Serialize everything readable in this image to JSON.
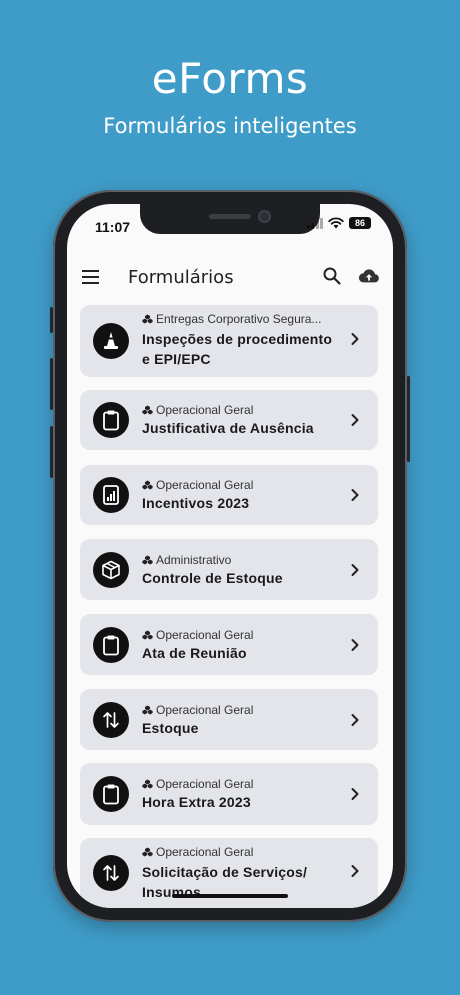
{
  "hero": {
    "title": "eForms",
    "subtitle": "Formulários inteligentes"
  },
  "status_bar": {
    "time": "11:07",
    "battery": "86"
  },
  "app_bar": {
    "title": "Formulários",
    "icons": [
      "menu-icon",
      "search-icon",
      "cloud-upload-icon"
    ]
  },
  "forms": [
    {
      "category": "Entregas Corporativo Segura...",
      "title": "Inspeções de procedimento e EPI/EPC",
      "icon": "traffic-cone-icon"
    },
    {
      "category": "Operacional Geral",
      "title": "Justificativa de Ausência",
      "icon": "clipboard-icon"
    },
    {
      "category": "Operacional Geral",
      "title": "Incentivos 2023",
      "icon": "chart-tablet-icon"
    },
    {
      "category": "Administrativo",
      "title": "Controle de Estoque",
      "icon": "box-icon"
    },
    {
      "category": "Operacional Geral",
      "title": "Ata de Reunião",
      "icon": "clipboard-icon"
    },
    {
      "category": "Operacional Geral",
      "title": "Estoque",
      "icon": "swap-arrows-icon"
    },
    {
      "category": "Operacional Geral",
      "title": "Hora Extra 2023",
      "icon": "clipboard-icon"
    },
    {
      "category": "Operacional Geral",
      "title": "Solicitação de Serviços/ Insumos",
      "icon": "swap-arrows-icon"
    }
  ],
  "colors": {
    "background": "#3f9cc8",
    "card": "#e3e5ea",
    "icon_circle": "#111111"
  }
}
